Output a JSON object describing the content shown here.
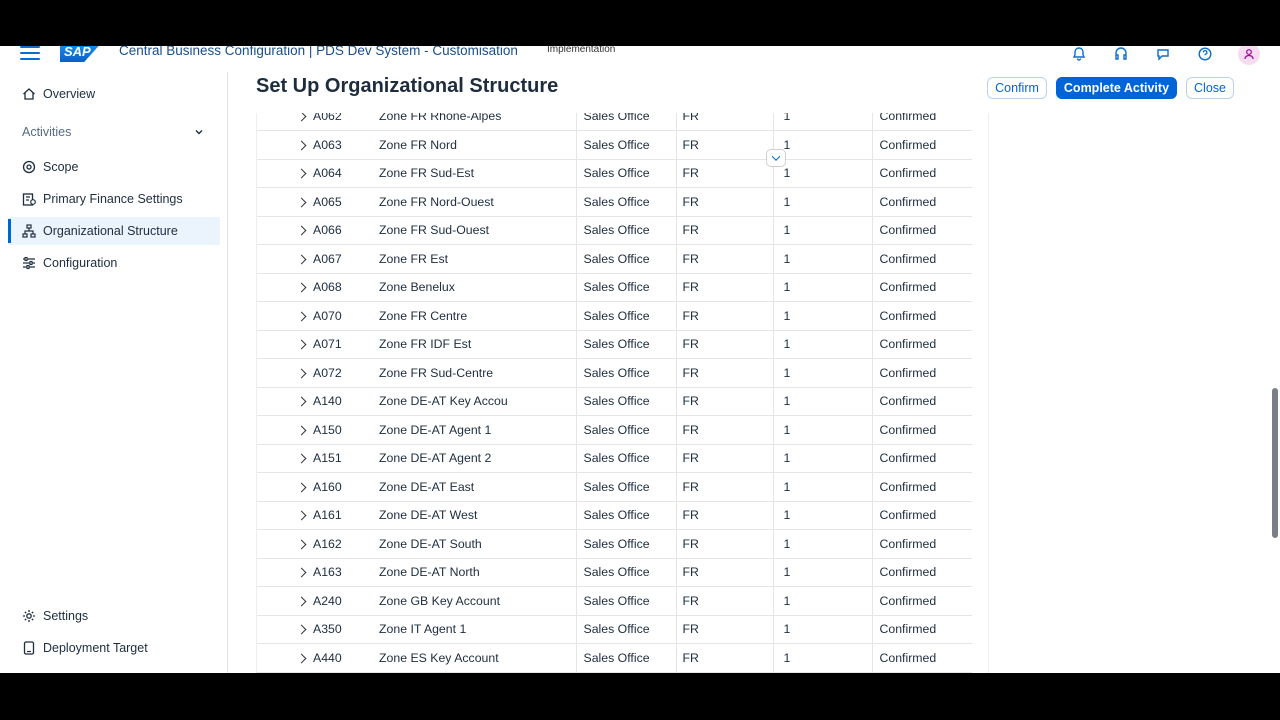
{
  "shell": {
    "logo_text": "SAP",
    "title": "Central Business Configuration | PDS Dev System - Customisation",
    "environment": "Implementation",
    "icons": [
      "bell-icon",
      "headset-icon",
      "chat-icon",
      "help-icon",
      "user-icon"
    ]
  },
  "sidebar": {
    "overview": "Overview",
    "activities_group": "Activities",
    "items": [
      {
        "label": "Scope",
        "icon": "target-icon"
      },
      {
        "label": "Primary Finance Settings",
        "icon": "finance-icon"
      },
      {
        "label": "Organizational Structure",
        "icon": "org-chart-icon"
      },
      {
        "label": "Configuration",
        "icon": "sliders-icon"
      }
    ],
    "settings": "Settings",
    "deployment_target": "Deployment Target"
  },
  "page": {
    "title": "Set Up Organizational Structure",
    "confirm_label": "Confirm",
    "complete_label": "Complete Activity",
    "close_label": "Close"
  },
  "table": {
    "partial_row": {
      "id": "A062",
      "name": "Zone FR Rhône-Alpes",
      "type": "Sales Office",
      "country": "FR",
      "level": "1",
      "status": "Confirmed"
    },
    "rows": [
      {
        "id": "A063",
        "name": "Zone FR Nord",
        "type": "Sales Office",
        "country": "FR",
        "level": "1",
        "status": "Confirmed"
      },
      {
        "id": "A064",
        "name": "Zone FR Sud-Est",
        "type": "Sales Office",
        "country": "FR",
        "level": "1",
        "status": "Confirmed"
      },
      {
        "id": "A065",
        "name": "Zone FR Nord-Ouest",
        "type": "Sales Office",
        "country": "FR",
        "level": "1",
        "status": "Confirmed"
      },
      {
        "id": "A066",
        "name": "Zone FR Sud-Ouest",
        "type": "Sales Office",
        "country": "FR",
        "level": "1",
        "status": "Confirmed"
      },
      {
        "id": "A067",
        "name": "Zone FR Est",
        "type": "Sales Office",
        "country": "FR",
        "level": "1",
        "status": "Confirmed"
      },
      {
        "id": "A068",
        "name": "Zone Benelux",
        "type": "Sales Office",
        "country": "FR",
        "level": "1",
        "status": "Confirmed"
      },
      {
        "id": "A070",
        "name": "Zone FR Centre",
        "type": "Sales Office",
        "country": "FR",
        "level": "1",
        "status": "Confirmed"
      },
      {
        "id": "A071",
        "name": "Zone FR IDF Est",
        "type": "Sales Office",
        "country": "FR",
        "level": "1",
        "status": "Confirmed"
      },
      {
        "id": "A072",
        "name": "Zone FR Sud-Centre",
        "type": "Sales Office",
        "country": "FR",
        "level": "1",
        "status": "Confirmed"
      },
      {
        "id": "A140",
        "name": "Zone DE-AT Key Accou",
        "type": "Sales Office",
        "country": "FR",
        "level": "1",
        "status": "Confirmed"
      },
      {
        "id": "A150",
        "name": "Zone DE-AT Agent 1",
        "type": "Sales Office",
        "country": "FR",
        "level": "1",
        "status": "Confirmed"
      },
      {
        "id": "A151",
        "name": "Zone DE-AT Agent 2",
        "type": "Sales Office",
        "country": "FR",
        "level": "1",
        "status": "Confirmed"
      },
      {
        "id": "A160",
        "name": "Zone DE-AT East",
        "type": "Sales Office",
        "country": "FR",
        "level": "1",
        "status": "Confirmed"
      },
      {
        "id": "A161",
        "name": "Zone DE-AT West",
        "type": "Sales Office",
        "country": "FR",
        "level": "1",
        "status": "Confirmed"
      },
      {
        "id": "A162",
        "name": "Zone DE-AT South",
        "type": "Sales Office",
        "country": "FR",
        "level": "1",
        "status": "Confirmed"
      },
      {
        "id": "A163",
        "name": "Zone DE-AT North",
        "type": "Sales Office",
        "country": "FR",
        "level": "1",
        "status": "Confirmed"
      },
      {
        "id": "A240",
        "name": "Zone GB Key Account",
        "type": "Sales Office",
        "country": "FR",
        "level": "1",
        "status": "Confirmed"
      },
      {
        "id": "A350",
        "name": "Zone IT Agent 1",
        "type": "Sales Office",
        "country": "FR",
        "level": "1",
        "status": "Confirmed"
      },
      {
        "id": "A440",
        "name": "Zone ES Key Account",
        "type": "Sales Office",
        "country": "FR",
        "level": "1",
        "status": "Confirmed"
      }
    ]
  },
  "colors": {
    "accent": "#0064d9",
    "nav_active_bg": "#ebf3fc",
    "title_link": "#1b4f8a"
  }
}
